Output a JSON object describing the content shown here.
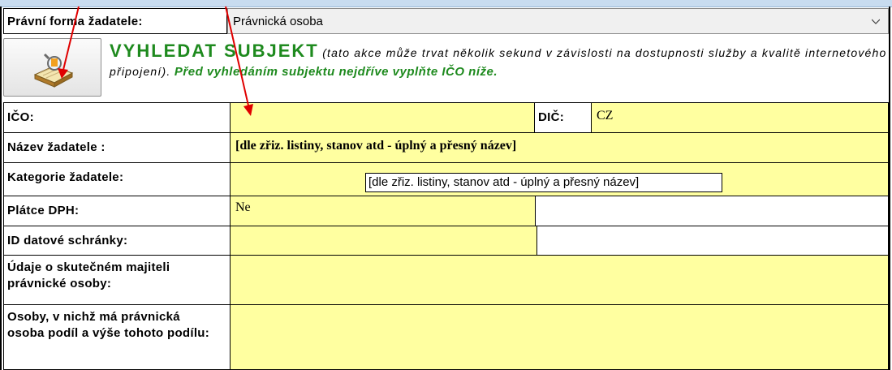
{
  "legal_form": {
    "label": "Právní forma žadatele:",
    "value": "Právnická osoba"
  },
  "search": {
    "title": "VYHLEDAT SUBJEKT",
    "note": "(tato akce může trvat několik sekund v závislosti na dostupnosti služby a kvalitě internetového připojení).",
    "hint": "Před vyhledáním subjektu nejdříve vyplňte IČO níže."
  },
  "fields": {
    "ico_label": "IČO:",
    "ico_value": "",
    "dic_label": "DIČ:",
    "dic_value": "CZ",
    "name_label": "Název žadatele :",
    "name_value": "[dle zřiz. listiny, stanov atd - úplný a přesný název]",
    "category_label": "Kategorie žadatele:",
    "category_value": "",
    "vat_label": "Plátce DPH:",
    "vat_value": "Ne",
    "databox_label": "ID datové schránky:",
    "databox_value": "",
    "owner_label": "Údaje o skutečném majiteli právnické osoby:",
    "owner_value": "",
    "shares_label": "Osoby, v nichž má právnická osoba podíl a výše tohoto podílu:",
    "shares_value": ""
  },
  "tooltip": {
    "text": "[dle zřiz. listiny, stanov atd - úplný a přesný název]"
  },
  "colors": {
    "input_fill": "#ffffa0",
    "accent_green": "#1e8a1e",
    "annotation_red": "#e00000"
  }
}
